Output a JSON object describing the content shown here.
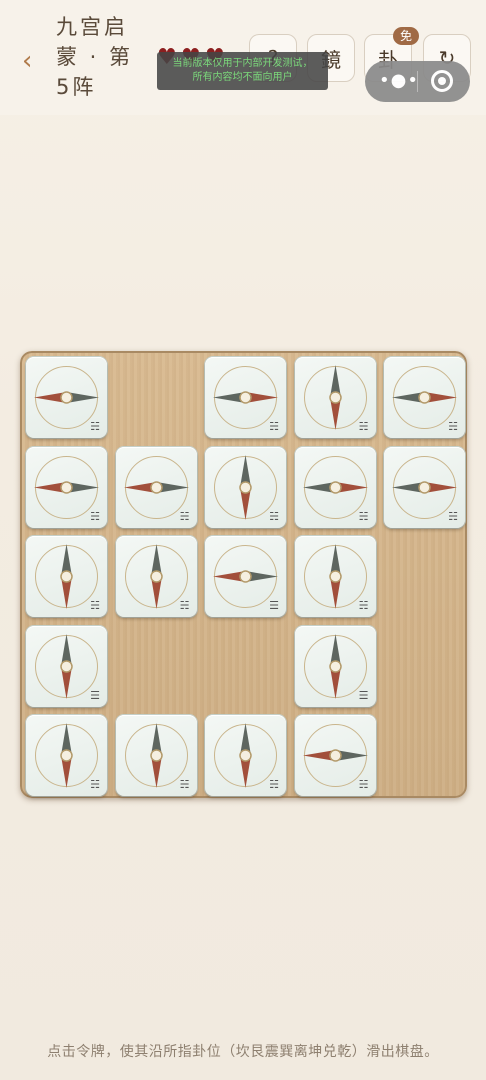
{
  "header": {
    "back_icon": "‹",
    "title": "九宫启蒙 · 第5阵",
    "lives": 3,
    "notice_line1": "当前版本仅用于内部开发测试，",
    "notice_line2": "所有内容均不面向用户",
    "buttons": [
      {
        "name": "hint-button",
        "label": "?"
      },
      {
        "name": "mirror-button",
        "label": "鏡"
      },
      {
        "name": "trigram-button",
        "label": "卦"
      },
      {
        "name": "reset-button",
        "label": "↻"
      }
    ],
    "free_badge": "免",
    "capsule_dots": "•●•"
  },
  "board": {
    "rows": 5,
    "cols": 5,
    "tiles": [
      {
        "row": 0,
        "col": 0,
        "dir": "W",
        "trigram": "☵"
      },
      {
        "row": 0,
        "col": 2,
        "dir": "E",
        "trigram": "☵"
      },
      {
        "row": 0,
        "col": 3,
        "dir": "S",
        "trigram": "☵"
      },
      {
        "row": 0,
        "col": 4,
        "dir": "E",
        "trigram": "☵"
      },
      {
        "row": 1,
        "col": 0,
        "dir": "W",
        "trigram": "☵"
      },
      {
        "row": 1,
        "col": 1,
        "dir": "W",
        "trigram": "☵"
      },
      {
        "row": 1,
        "col": 2,
        "dir": "S",
        "trigram": "☵"
      },
      {
        "row": 1,
        "col": 3,
        "dir": "E",
        "trigram": "☵"
      },
      {
        "row": 1,
        "col": 4,
        "dir": "E",
        "trigram": "☵"
      },
      {
        "row": 2,
        "col": 0,
        "dir": "S",
        "trigram": "☵"
      },
      {
        "row": 2,
        "col": 1,
        "dir": "S",
        "trigram": "☵"
      },
      {
        "row": 2,
        "col": 2,
        "dir": "W",
        "trigram": "☰"
      },
      {
        "row": 2,
        "col": 3,
        "dir": "S",
        "trigram": "☵"
      },
      {
        "row": 3,
        "col": 0,
        "dir": "S",
        "trigram": "☰"
      },
      {
        "row": 3,
        "col": 3,
        "dir": "S",
        "trigram": "☰"
      },
      {
        "row": 4,
        "col": 0,
        "dir": "S",
        "trigram": "☵"
      },
      {
        "row": 4,
        "col": 1,
        "dir": "S",
        "trigram": "☵"
      },
      {
        "row": 4,
        "col": 2,
        "dir": "S",
        "trigram": "☵"
      },
      {
        "row": 4,
        "col": 3,
        "dir": "W",
        "trigram": "☵"
      }
    ]
  },
  "colors": {
    "needle_red": "#a24f3b",
    "needle_dark": "#5e6660",
    "ring": "#c9b58c"
  },
  "footer": {
    "instruction": "点击令牌，使其沿所指卦位（坎艮震巽离坤兑乾）滑出棋盘。"
  }
}
